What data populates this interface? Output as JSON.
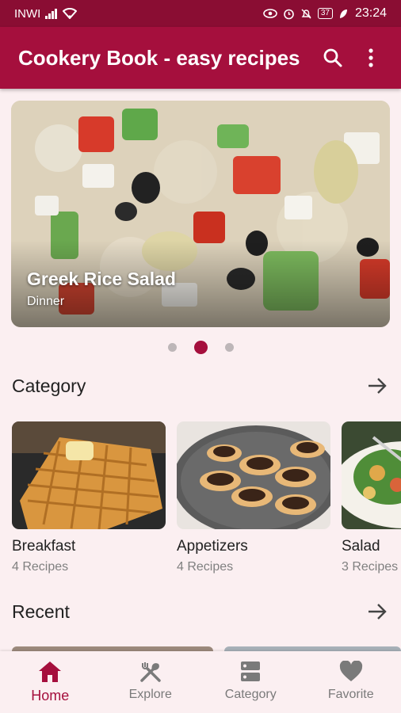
{
  "status": {
    "carrier": "INWI",
    "battery": "37",
    "time": "23:24"
  },
  "appbar": {
    "title": "Cookery Book - easy recipes",
    "search_icon": "search-icon",
    "menu_icon": "more-vert-icon"
  },
  "featured": {
    "name": "Greek Rice Salad",
    "category": "Dinner",
    "page_count": 3,
    "active_page": 2
  },
  "category_section": {
    "title": "Category"
  },
  "categories": [
    {
      "name": "Breakfast",
      "count": "4 Recipes"
    },
    {
      "name": "Appetizers",
      "count": "4 Recipes"
    },
    {
      "name": "Salad",
      "count": "3 Recipes"
    }
  ],
  "recent_section": {
    "title": "Recent"
  },
  "nav": [
    {
      "label": "Home",
      "icon": "home-icon",
      "active": true
    },
    {
      "label": "Explore",
      "icon": "fork-knife-icon",
      "active": false
    },
    {
      "label": "Category",
      "icon": "category-icon",
      "active": false
    },
    {
      "label": "Favorite",
      "icon": "heart-icon",
      "active": false
    }
  ],
  "colors": {
    "primary": "#a50f3d",
    "status_bar": "#8a0d33",
    "background": "#fbeff1"
  }
}
